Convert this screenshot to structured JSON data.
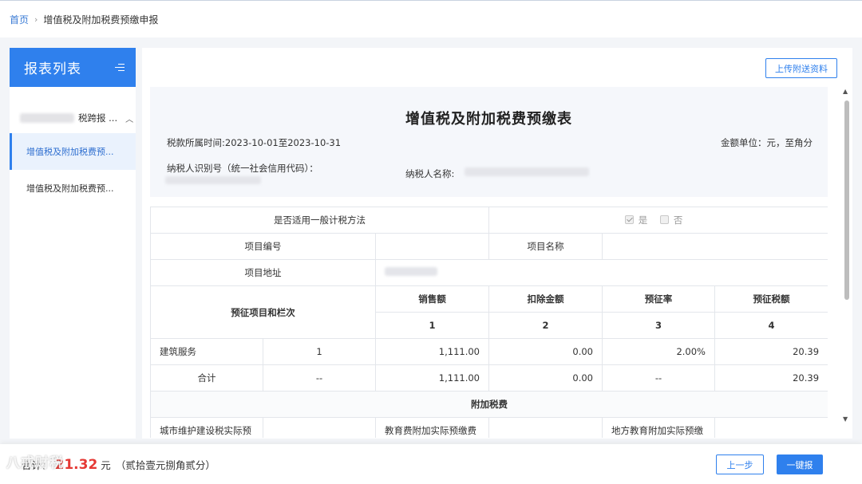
{
  "breadcrumb": {
    "home": "首页",
    "separator": "›",
    "current": "增值税及附加税费预缴申报"
  },
  "sidebar": {
    "title": "报表列表",
    "group_label": "税跨报 ...",
    "group_icon": "chevron-up-icon",
    "items": [
      {
        "label": "增值税及附加税费预...",
        "active": true
      },
      {
        "label": "增值税及附加税费预...",
        "active": false
      }
    ]
  },
  "main": {
    "upload_button": "上传附送资料",
    "form_title": "增值税及附加税费预缴表",
    "period": "税款所属时间:2023-10-01至2023-10-31",
    "unit": "金额单位：元，至角分",
    "taxpayer_id_label": "纳税人识别号（统一社会信用代码）：",
    "taxpayer_name_label": "纳税人名称:"
  },
  "table": {
    "general_method_label": "是否适用一般计税方法",
    "option_yes": "是",
    "option_no": "否",
    "yes_checked": true,
    "no_checked": false,
    "project_no_label": "项目编号",
    "project_name_label": "项目名称",
    "project_addr_label": "项目地址",
    "items_label": "预征项目和栏次",
    "headers": [
      "销售额",
      "扣除金额",
      "预征率",
      "预征税额"
    ],
    "col_numbers": [
      "1",
      "2",
      "3",
      "4"
    ],
    "rows": [
      {
        "name": "建筑服务",
        "line": "1",
        "sales": "1,111.00",
        "deduct": "0.00",
        "rate": "2.00%",
        "tax": "20.39"
      },
      {
        "name": "合计",
        "line": "--",
        "sales": "1,111.00",
        "deduct": "0.00",
        "rate": "--",
        "tax": "20.39"
      }
    ],
    "surtax_title": "附加税费",
    "surtax_partial": [
      "城市维护建设税实际预",
      "教育费附加实际预缴费",
      "地方教育附加实际预缴"
    ]
  },
  "footer": {
    "total_label": "合计：",
    "total_amount": "21.32",
    "total_unit": "元",
    "total_words": "（贰拾壹元捌角贰分）",
    "prev_button": "上一步",
    "submit_button": "一键报"
  },
  "watermark": "八戒财税",
  "colors": {
    "primary": "#2f80ed",
    "amount": "#e53935"
  }
}
